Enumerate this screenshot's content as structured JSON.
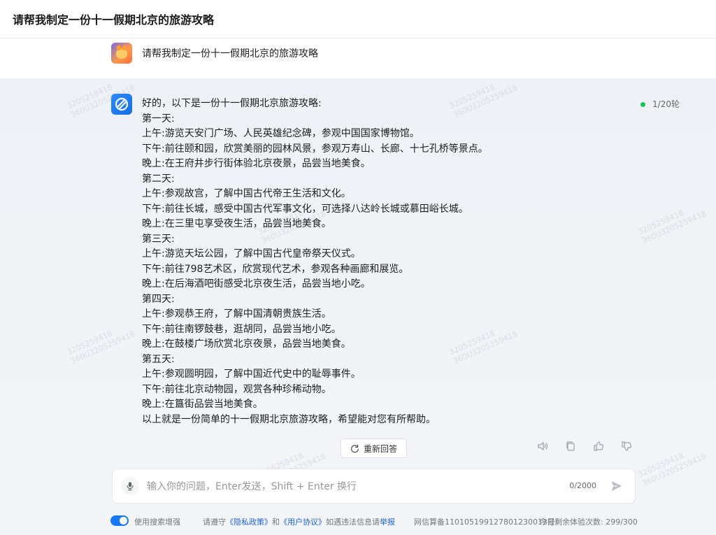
{
  "header": {
    "title": "请帮我制定一份十一假期北京的旅游攻略"
  },
  "user_message": {
    "avatar": "fox-avatar",
    "text": "请帮我制定一份十一假期北京的旅游攻略"
  },
  "bot_message": {
    "avatar": "blue-robot-avatar",
    "status": "1/20轮",
    "lines": [
      "好的，以下是一份十一假期北京旅游攻略:",
      "第一天:",
      "上午:游览天安门广场、人民英雄纪念碑，参观中国国家博物馆。",
      "下午:前往颐和园，欣赏美丽的园林风景，参观万寿山、长廊、十七孔桥等景点。",
      "晚上:在王府井步行街体验北京夜景，品尝当地美食。",
      "第二天:",
      "上午:参观故宫，了解中国古代帝王生活和文化。",
      "下午:前往长城，感受中国古代军事文化，可选择八达岭长城或慕田峪长城。",
      "晚上:在三里屯享受夜生活，品尝当地美食。",
      "第三天:",
      "上午:游览天坛公园，了解中国古代皇帝祭天仪式。",
      "下午:前往798艺术区，欣赏现代艺术，参观各种画廊和展览。",
      "晚上:在后海酒吧街感受北京夜生活，品尝当地小吃。",
      "第四天:",
      "上午:参观恭王府，了解中国清朝贵族生活。",
      "下午:前往南锣鼓巷，逛胡同，品尝当地小吃。",
      "晚上:在鼓楼广场欣赏北京夜景，品尝当地美食。",
      "第五天:",
      "上午:参观圆明园，了解中国近代史中的耻辱事件。",
      "下午:前往北京动物园，观赏各种珍稀动物。",
      "晚上:在簋街品尝当地美食。",
      "以上就是一份简单的十一假期北京旅游攻略，希望能对您有所帮助。"
    ]
  },
  "actions": {
    "retry_label": "重新回答",
    "tool_icons": [
      "speaker-icon",
      "copy-icon",
      "thumbs-up-icon",
      "thumbs-down-icon"
    ]
  },
  "input": {
    "placeholder": "输入你的问题，Enter发送，Shift + Enter 换行",
    "counter": "0/2000",
    "mic_icon": "microphone-icon",
    "send_icon": "send-icon"
  },
  "footer": {
    "search_label": "使用搜索增强",
    "notice_prefix": "请遵守",
    "privacy": "《隐私政策》",
    "notice_and": "和",
    "agreement": "《用户协议》",
    "notice_suffix": "如遇违法信息请",
    "report": "举报",
    "filing": "网信算备110105199127801230013号",
    "quota": "今日剩余体验次数: 299/300"
  },
  "watermark": {
    "line1": "3205259418",
    "line2": "360U3205259418"
  },
  "colors": {
    "accent": "#1677ff",
    "status": "#19c05a",
    "background": "#f3f5f8"
  }
}
